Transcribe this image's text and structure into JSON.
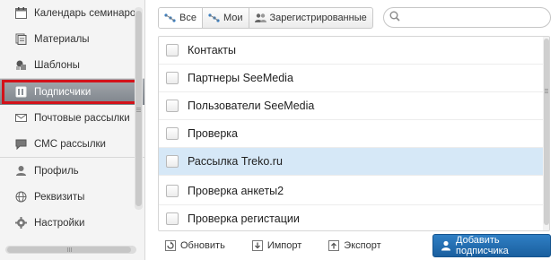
{
  "sidebar": {
    "groups": [
      [
        {
          "label": "Календарь семинаров",
          "icon": "calendar-icon"
        },
        {
          "label": "Материалы",
          "icon": "materials-icon"
        },
        {
          "label": "Шаблоны",
          "icon": "templates-icon"
        }
      ],
      [
        {
          "label": "Подписчики",
          "icon": "subscribers-icon",
          "active": true
        },
        {
          "label": "Почтовые рассылки",
          "icon": "mail-icon"
        },
        {
          "label": "СМС рассылки",
          "icon": "sms-icon"
        }
      ],
      [
        {
          "label": "Профиль",
          "icon": "user-icon"
        },
        {
          "label": "Реквизиты",
          "icon": "globe-icon"
        },
        {
          "label": "Настройки",
          "icon": "gear-icon"
        }
      ]
    ]
  },
  "tabs": [
    {
      "label": "Все",
      "active": true
    },
    {
      "label": "Мои",
      "active": false
    },
    {
      "label": "Зарегистрированные",
      "active": false
    }
  ],
  "search": {
    "placeholder": "",
    "value": ""
  },
  "list": {
    "items": [
      {
        "label": "Контакты",
        "selected": false
      },
      {
        "label": "Партнеры SeeMedia",
        "selected": false
      },
      {
        "label": "Пользователи SeeMedia",
        "selected": false
      },
      {
        "label": "Проверка",
        "selected": false
      },
      {
        "label": "Рассылка Treko.ru",
        "selected": true
      },
      {
        "label": "Проверка анкеты2",
        "selected": false
      },
      {
        "label": "Проверка регистации",
        "selected": false
      }
    ]
  },
  "toolbar": {
    "refresh_label": "Обновить",
    "import_label": "Импорт",
    "export_label": "Экспорт",
    "add_label": "Добавить подписчика"
  },
  "colors": {
    "accent": "#1f6fb2",
    "selection": "#d6e8f7",
    "highlight_frame": "#d3121a",
    "active_item": "#8a9096"
  }
}
